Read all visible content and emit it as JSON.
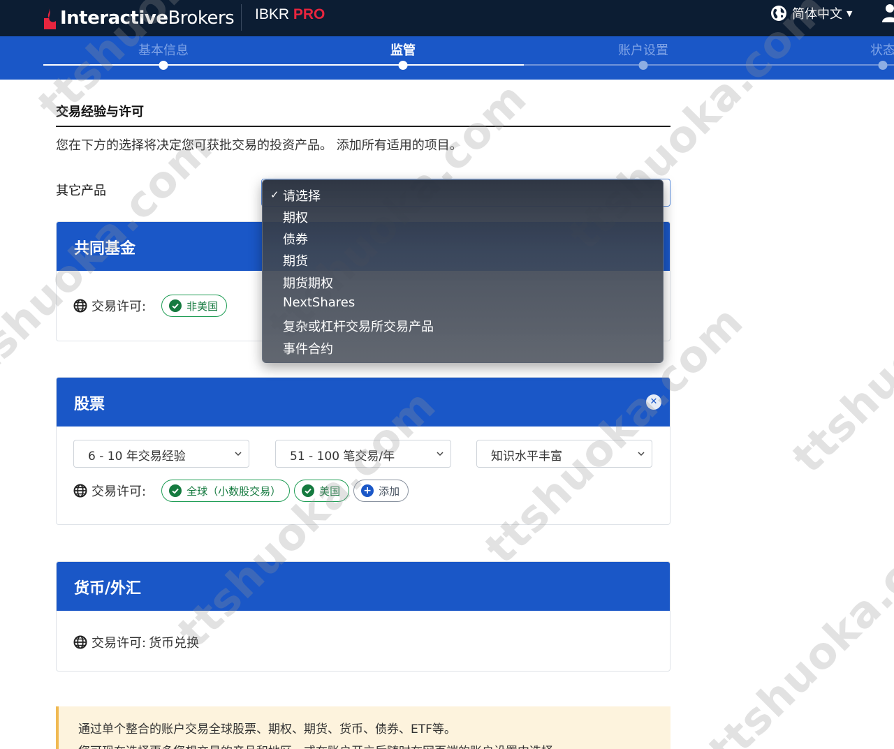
{
  "header": {
    "logo_text_bold": "Interactive",
    "logo_text_light": "Brokers",
    "product_prefix": "IBKR",
    "product_suffix": "PRO",
    "language": "简体中文"
  },
  "steps": [
    {
      "label": "基本信息",
      "state": "done"
    },
    {
      "label": "监管",
      "state": "active"
    },
    {
      "label": "账户设置",
      "state": "pending"
    },
    {
      "label": "状态",
      "state": "pending"
    }
  ],
  "section": {
    "title": "交易经验与许可",
    "intro": "您在下方的选择将决定您可获批交易的投资产品。 添加所有适用的项目。",
    "other_products_label": "其它产品"
  },
  "product_menu": {
    "selected": "请选择",
    "options": [
      "请选择",
      "期权",
      "债券",
      "期货",
      "期货期权",
      "NextShares",
      "复杂或杠杆交易所交易产品",
      "事件合约"
    ]
  },
  "cards": {
    "mutual_funds": {
      "title": "共同基金",
      "perm_label": "交易许可:",
      "permissions": [
        "非美国"
      ]
    },
    "stocks": {
      "title": "股票",
      "experience": "6 - 10 年交易经验",
      "trades": "51 - 100 笔交易/年",
      "knowledge": "知识水平丰富",
      "perm_label": "交易许可:",
      "permissions": [
        "全球（小数股交易）",
        "美国"
      ],
      "add_label": "添加"
    },
    "forex": {
      "title": "货币/外汇",
      "perm_label": "交易许可:",
      "perm_value": "货币兑换"
    }
  },
  "notice": {
    "line1": "通过单个整合的账户交易全球股票、期权、期货、货币、债券、ETF等。",
    "line2": "您可现在选择更多您想交易的产品和地区，或在账户开立后随时在网页端的账户设置中选择"
  },
  "watermark": "ttshuoka.com",
  "colors": {
    "topbar": "#0c1d33",
    "brand_blue": "#1a57c7",
    "brand_red": "#e8253e",
    "permission_green": "#1f9d55",
    "notice_bg": "#fdf3dd"
  }
}
